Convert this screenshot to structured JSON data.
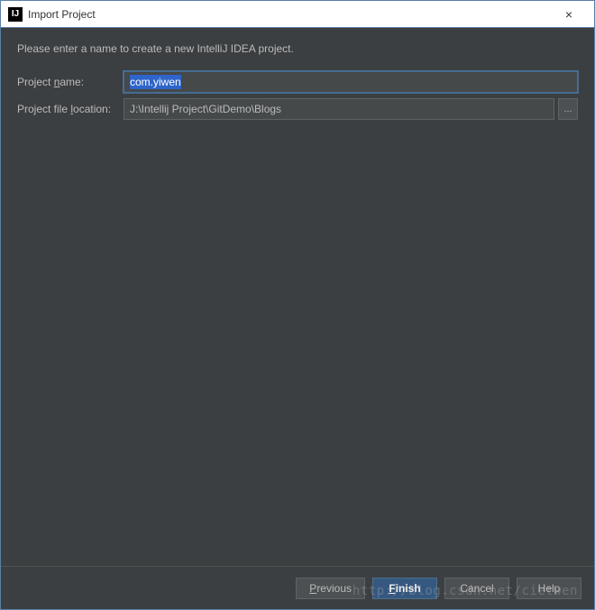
{
  "titlebar": {
    "icon_text": "IJ",
    "title": "Import Project",
    "close": "×"
  },
  "content": {
    "instruction": "Please enter a name to create a new IntelliJ IDEA project."
  },
  "form": {
    "project_name": {
      "label_pre": "Project ",
      "label_mn": "n",
      "label_post": "ame:",
      "value": "com.yiwen"
    },
    "project_location": {
      "label_pre": "Project file ",
      "label_mn": "l",
      "label_post": "ocation:",
      "value": "J:\\Intellij Project\\GitDemo\\Blogs",
      "browse": "..."
    }
  },
  "buttons": {
    "previous_mn": "P",
    "previous_post": "revious",
    "finish_mn": "F",
    "finish_post": "inish",
    "cancel": "Cancel",
    "help": "Help"
  },
  "watermark": "http://blog.csdn.net/cietwen"
}
